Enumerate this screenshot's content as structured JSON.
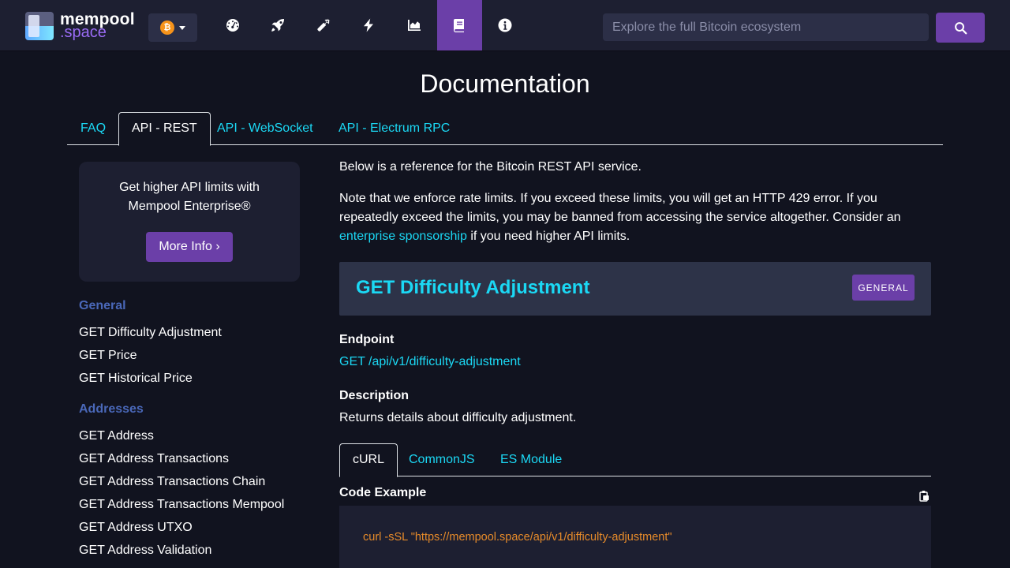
{
  "brand": {
    "line1": "mempool",
    "line2": ".space"
  },
  "network": {
    "icon": "bitcoin-icon",
    "symbol": "₿",
    "color": "#f7931a"
  },
  "nav": [
    {
      "name": "dashboard-icon"
    },
    {
      "name": "rocket-icon"
    },
    {
      "name": "mining-icon"
    },
    {
      "name": "lightning-icon"
    },
    {
      "name": "graphs-icon"
    },
    {
      "name": "docs-icon",
      "active": true
    },
    {
      "name": "info-icon"
    }
  ],
  "search": {
    "placeholder": "Explore the full Bitcoin ecosystem"
  },
  "colors": {
    "accent": "#6b3fa8",
    "link": "#1bd8f4",
    "group": "#4a68b9",
    "code": "#e78b2a",
    "background": "#11131f",
    "panel": "#1d1f31"
  },
  "page": {
    "title": "Documentation"
  },
  "doc_tabs": [
    "FAQ",
    "API - REST",
    "API - WebSocket",
    "API - Electrum RPC"
  ],
  "promo": {
    "text": "Get higher API limits with Mempool Enterprise®",
    "button": "More Info ›"
  },
  "sidebar": {
    "groups": [
      {
        "title": "General",
        "items": [
          "GET Difficulty Adjustment",
          "GET Price",
          "GET Historical Price"
        ]
      },
      {
        "title": "Addresses",
        "items": [
          "GET Address",
          "GET Address Transactions",
          "GET Address Transactions Chain",
          "GET Address Transactions Mempool",
          "GET Address UTXO",
          "GET Address Validation"
        ]
      }
    ]
  },
  "intro": {
    "line1": "Below is a reference for the Bitcoin REST API service.",
    "line2_before": "Note that we enforce rate limits. If you exceed these limits, you will get an HTTP 429 error. If you repeatedly exceed the limits, you may be banned from accessing the service altogether. Consider an ",
    "line2_link": "enterprise sponsorship",
    "line2_after": " if you need higher API limits."
  },
  "endpoint": {
    "title": "GET Difficulty Adjustment",
    "badge": "GENERAL",
    "endpoint_label": "Endpoint",
    "endpoint_value": "GET /api/v1/difficulty-adjustment",
    "description_label": "Description",
    "description_value": "Returns details about difficulty adjustment.",
    "code_tabs": [
      "cURL",
      "CommonJS",
      "ES Module"
    ],
    "code_label": "Code Example",
    "code": "curl -sSL \"https://mempool.space/api/v1/difficulty-adjustment\""
  }
}
